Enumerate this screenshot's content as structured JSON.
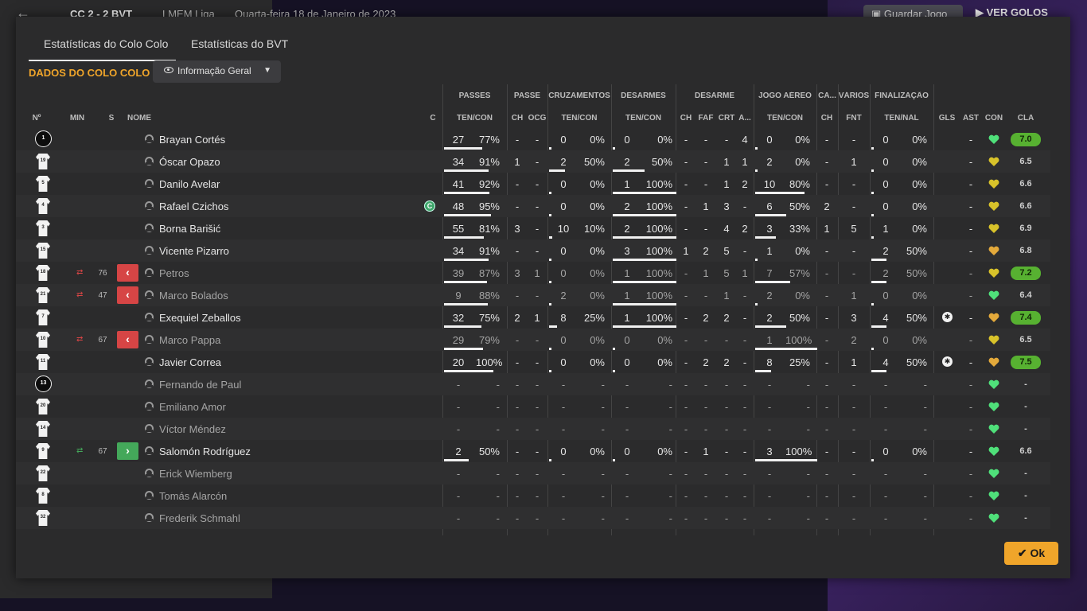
{
  "topbar": {
    "back_icon": "arrow-left-icon",
    "score": "CC  2 - 2  BVT",
    "competition": "LMEM Liga",
    "date": "Quarta-feira 18 de Janeiro de 2023",
    "save_label": "Guardar Jogo",
    "save_icon": "save-icon",
    "goals_label": "VER GOLOS"
  },
  "tabs": [
    {
      "label": "Estatísticas do Colo Colo",
      "active": true
    },
    {
      "label": "Estatísticas do BVT",
      "active": false
    }
  ],
  "team_heading": "DADOS DO COLO COLO",
  "view_dropdown": {
    "label": "Informação Geral",
    "icon": "eye-icon"
  },
  "groups": {
    "passes": "PASSES",
    "passe": "PASSE",
    "cruzamentos": "CRUZAMENTOS",
    "desarmes": "DESARMES",
    "desarme": "DESARME",
    "jogo_aereo": "JOGO AÉREO",
    "ca": "CA...",
    "varios": "VÁRIOS",
    "finalizacao": "FINALIZAÇÃO"
  },
  "columns": {
    "num": "Nº",
    "min": "MIN",
    "s": "S",
    "nome": "NOME",
    "c": "C",
    "ten_con": "TEN/CON",
    "ch": "CH",
    "ocg": "OCG",
    "faf": "FAF",
    "crt": "CRT",
    "a": "A...",
    "fnt": "FNT",
    "ten_nal": "TEN/NAL",
    "gls": "GLS",
    "ast": "AST",
    "con": "CON",
    "cla": "CLA"
  },
  "rows": [
    {
      "num": "1",
      "gk": true,
      "name": "Brayan Cortés",
      "dim": false,
      "min": "",
      "sub": "",
      "cap": false,
      "pass": [
        "27",
        "77%"
      ],
      "pass_fill": 0.77,
      "pch": "-",
      "ocg": "-",
      "cross": [
        "0",
        "0%"
      ],
      "cross_fill": 0,
      "tack": [
        "0",
        "0%"
      ],
      "tack_fill": 0,
      "dch": "-",
      "faf": "-",
      "crt": "-",
      "a": "4",
      "air": [
        "0",
        "0%"
      ],
      "air_fill": 0,
      "cach": "-",
      "fnt": "-",
      "shot": [
        "0",
        "0%"
      ],
      "shot_fill": 0,
      "gls": "",
      "ast": "-",
      "morale": "green",
      "rating": "7.0",
      "rating_hi": true
    },
    {
      "num": "19",
      "gk": false,
      "name": "Óscar Opazo",
      "dim": false,
      "min": "",
      "sub": "",
      "cap": false,
      "pass": [
        "34",
        "91%"
      ],
      "pass_fill": 0.91,
      "pch": "1",
      "ocg": "-",
      "cross": [
        "2",
        "50%"
      ],
      "cross_fill": 0.5,
      "tack": [
        "2",
        "50%"
      ],
      "tack_fill": 0.5,
      "dch": "-",
      "faf": "-",
      "crt": "1",
      "a": "1",
      "air": [
        "2",
        "0%"
      ],
      "air_fill": 0,
      "cach": "-",
      "fnt": "1",
      "shot": [
        "0",
        "0%"
      ],
      "shot_fill": 0,
      "gls": "",
      "ast": "-",
      "morale": "yellow",
      "rating": "6.5",
      "rating_hi": false
    },
    {
      "num": "5",
      "gk": false,
      "name": "Danilo Avelar",
      "dim": false,
      "min": "",
      "sub": "",
      "cap": false,
      "pass": [
        "41",
        "92%"
      ],
      "pass_fill": 0.92,
      "pch": "-",
      "ocg": "-",
      "cross": [
        "0",
        "0%"
      ],
      "cross_fill": 0,
      "tack": [
        "1",
        "100%"
      ],
      "tack_fill": 1,
      "dch": "-",
      "faf": "-",
      "crt": "1",
      "a": "2",
      "air": [
        "10",
        "80%"
      ],
      "air_fill": 0.8,
      "cach": "-",
      "fnt": "-",
      "shot": [
        "0",
        "0%"
      ],
      "shot_fill": 0,
      "gls": "",
      "ast": "-",
      "morale": "yellow",
      "rating": "6.6",
      "rating_hi": false
    },
    {
      "num": "4",
      "gk": false,
      "name": "Rafael Czichos",
      "dim": false,
      "min": "",
      "sub": "",
      "cap": true,
      "pass": [
        "48",
        "95%"
      ],
      "pass_fill": 0.95,
      "pch": "-",
      "ocg": "-",
      "cross": [
        "0",
        "0%"
      ],
      "cross_fill": 0,
      "tack": [
        "2",
        "100%"
      ],
      "tack_fill": 1,
      "dch": "-",
      "faf": "1",
      "crt": "3",
      "a": "-",
      "air": [
        "6",
        "50%"
      ],
      "air_fill": 0.5,
      "cach": "2",
      "fnt": "-",
      "shot": [
        "0",
        "0%"
      ],
      "shot_fill": 0,
      "gls": "",
      "ast": "-",
      "morale": "yellow",
      "rating": "6.6",
      "rating_hi": false
    },
    {
      "num": "3",
      "gk": false,
      "name": "Borna Barišić",
      "dim": false,
      "min": "",
      "sub": "",
      "cap": false,
      "pass": [
        "55",
        "81%"
      ],
      "pass_fill": 0.81,
      "pch": "3",
      "ocg": "-",
      "cross": [
        "10",
        "10%"
      ],
      "cross_fill": 0.1,
      "tack": [
        "2",
        "100%"
      ],
      "tack_fill": 1,
      "dch": "-",
      "faf": "-",
      "crt": "4",
      "a": "2",
      "air": [
        "3",
        "33%"
      ],
      "air_fill": 0.33,
      "cach": "1",
      "fnt": "5",
      "shot": [
        "1",
        "0%"
      ],
      "shot_fill": 0,
      "gls": "",
      "ast": "-",
      "morale": "yellow",
      "rating": "6.9",
      "rating_hi": false
    },
    {
      "num": "15",
      "gk": false,
      "name": "Vicente Pizarro",
      "dim": false,
      "min": "",
      "sub": "",
      "cap": false,
      "pass": [
        "34",
        "91%"
      ],
      "pass_fill": 0.91,
      "pch": "-",
      "ocg": "-",
      "cross": [
        "0",
        "0%"
      ],
      "cross_fill": 0,
      "tack": [
        "3",
        "100%"
      ],
      "tack_fill": 1,
      "dch": "1",
      "faf": "2",
      "crt": "5",
      "a": "-",
      "air": [
        "1",
        "0%"
      ],
      "air_fill": 0,
      "cach": "-",
      "fnt": "-",
      "shot": [
        "2",
        "50%"
      ],
      "shot_fill": 0.5,
      "gls": "",
      "ast": "-",
      "morale": "orange",
      "rating": "6.8",
      "rating_hi": false
    },
    {
      "num": "18",
      "gk": false,
      "name": "Petros",
      "dim": true,
      "min": "76",
      "sub": "off",
      "cap": false,
      "pass": [
        "39",
        "87%"
      ],
      "pass_fill": 0.87,
      "pch": "3",
      "ocg": "1",
      "cross": [
        "0",
        "0%"
      ],
      "cross_fill": 0,
      "tack": [
        "1",
        "100%"
      ],
      "tack_fill": 1,
      "dch": "-",
      "faf": "1",
      "crt": "5",
      "a": "1",
      "air": [
        "7",
        "57%"
      ],
      "air_fill": 0.57,
      "cach": "-",
      "fnt": "-",
      "shot": [
        "2",
        "50%"
      ],
      "shot_fill": 0.5,
      "gls": "",
      "ast": "-",
      "morale": "yellow",
      "rating": "7.2",
      "rating_hi": true
    },
    {
      "num": "21",
      "gk": false,
      "name": "Marco Bolados",
      "dim": true,
      "min": "47",
      "sub": "off",
      "cap": false,
      "pass": [
        "9",
        "88%"
      ],
      "pass_fill": 0.88,
      "pch": "-",
      "ocg": "-",
      "cross": [
        "2",
        "0%"
      ],
      "cross_fill": 0,
      "tack": [
        "1",
        "100%"
      ],
      "tack_fill": 1,
      "dch": "-",
      "faf": "-",
      "crt": "1",
      "a": "-",
      "air": [
        "2",
        "0%"
      ],
      "air_fill": 0,
      "cach": "-",
      "fnt": "1",
      "shot": [
        "0",
        "0%"
      ],
      "shot_fill": 0,
      "gls": "",
      "ast": "-",
      "morale": "green",
      "rating": "6.4",
      "rating_hi": false
    },
    {
      "num": "7",
      "gk": false,
      "name": "Exequiel Zeballos",
      "dim": false,
      "min": "",
      "sub": "",
      "cap": false,
      "pass": [
        "32",
        "75%"
      ],
      "pass_fill": 0.75,
      "pch": "2",
      "ocg": "1",
      "cross": [
        "8",
        "25%"
      ],
      "cross_fill": 0.25,
      "tack": [
        "1",
        "100%"
      ],
      "tack_fill": 1,
      "dch": "-",
      "faf": "2",
      "crt": "2",
      "a": "-",
      "air": [
        "2",
        "50%"
      ],
      "air_fill": 0.5,
      "cach": "-",
      "fnt": "3",
      "shot": [
        "4",
        "50%"
      ],
      "shot_fill": 0.5,
      "gls": "ball",
      "ast": "-",
      "morale": "orange",
      "rating": "7.4",
      "rating_hi": true
    },
    {
      "num": "10",
      "gk": false,
      "name": "Marco Pappa",
      "dim": true,
      "min": "67",
      "sub": "off",
      "cap": false,
      "pass": [
        "29",
        "79%"
      ],
      "pass_fill": 0.79,
      "pch": "-",
      "ocg": "-",
      "cross": [
        "0",
        "0%"
      ],
      "cross_fill": 0,
      "tack": [
        "0",
        "0%"
      ],
      "tack_fill": 0,
      "dch": "-",
      "faf": "-",
      "crt": "-",
      "a": "-",
      "air": [
        "1",
        "100%"
      ],
      "air_fill": 1,
      "cach": "-",
      "fnt": "2",
      "shot": [
        "0",
        "0%"
      ],
      "shot_fill": 0,
      "gls": "",
      "ast": "-",
      "morale": "yellow",
      "rating": "6.5",
      "rating_hi": false
    },
    {
      "num": "11",
      "gk": false,
      "name": "Javier Correa",
      "dim": false,
      "min": "",
      "sub": "",
      "cap": false,
      "pass": [
        "20",
        "100%"
      ],
      "pass_fill": 1,
      "pch": "-",
      "ocg": "-",
      "cross": [
        "0",
        "0%"
      ],
      "cross_fill": 0,
      "tack": [
        "0",
        "0%"
      ],
      "tack_fill": 0,
      "dch": "-",
      "faf": "2",
      "crt": "2",
      "a": "-",
      "air": [
        "8",
        "25%"
      ],
      "air_fill": 0.25,
      "cach": "-",
      "fnt": "1",
      "shot": [
        "4",
        "50%"
      ],
      "shot_fill": 0.5,
      "gls": "ball",
      "ast": "-",
      "morale": "orange",
      "rating": "7.5",
      "rating_hi": true
    },
    {
      "num": "13",
      "gk": true,
      "name": "Fernando de Paul",
      "dim": true,
      "min": "",
      "sub": "",
      "cap": false,
      "pass": [
        "-",
        "-"
      ],
      "pass_fill": null,
      "pch": "-",
      "ocg": "-",
      "cross": [
        "-",
        "-"
      ],
      "cross_fill": null,
      "tack": [
        "-",
        "-"
      ],
      "tack_fill": null,
      "dch": "-",
      "faf": "-",
      "crt": "-",
      "a": "-",
      "air": [
        "-",
        "-"
      ],
      "air_fill": null,
      "cach": "-",
      "fnt": "-",
      "shot": [
        "-",
        "-"
      ],
      "shot_fill": null,
      "gls": "",
      "ast": "-",
      "morale": "green",
      "rating": "-",
      "rating_hi": false
    },
    {
      "num": "20",
      "gk": false,
      "name": "Emiliano Amor",
      "dim": true,
      "min": "",
      "sub": "",
      "cap": false,
      "pass": [
        "-",
        "-"
      ],
      "pass_fill": null,
      "pch": "-",
      "ocg": "-",
      "cross": [
        "-",
        "-"
      ],
      "cross_fill": null,
      "tack": [
        "-",
        "-"
      ],
      "tack_fill": null,
      "dch": "-",
      "faf": "-",
      "crt": "-",
      "a": "-",
      "air": [
        "-",
        "-"
      ],
      "air_fill": null,
      "cach": "-",
      "fnt": "-",
      "shot": [
        "-",
        "-"
      ],
      "shot_fill": null,
      "gls": "",
      "ast": "-",
      "morale": "green",
      "rating": "-",
      "rating_hi": false
    },
    {
      "num": "14",
      "gk": false,
      "name": "Víctor Méndez",
      "dim": true,
      "min": "",
      "sub": "",
      "cap": false,
      "pass": [
        "-",
        "-"
      ],
      "pass_fill": null,
      "pch": "-",
      "ocg": "-",
      "cross": [
        "-",
        "-"
      ],
      "cross_fill": null,
      "tack": [
        "-",
        "-"
      ],
      "tack_fill": null,
      "dch": "-",
      "faf": "-",
      "crt": "-",
      "a": "-",
      "air": [
        "-",
        "-"
      ],
      "air_fill": null,
      "cach": "-",
      "fnt": "-",
      "shot": [
        "-",
        "-"
      ],
      "shot_fill": null,
      "gls": "",
      "ast": "-",
      "morale": "green",
      "rating": "-",
      "rating_hi": false
    },
    {
      "num": "9",
      "gk": false,
      "name": "Salomón Rodríguez",
      "dim": false,
      "min": "67",
      "sub": "on",
      "cap": false,
      "pass": [
        "2",
        "50%"
      ],
      "pass_fill": 0.5,
      "pch": "-",
      "ocg": "-",
      "cross": [
        "0",
        "0%"
      ],
      "cross_fill": 0,
      "tack": [
        "0",
        "0%"
      ],
      "tack_fill": 0,
      "dch": "-",
      "faf": "1",
      "crt": "-",
      "a": "-",
      "air": [
        "3",
        "100%"
      ],
      "air_fill": 1,
      "cach": "-",
      "fnt": "-",
      "shot": [
        "0",
        "0%"
      ],
      "shot_fill": 0,
      "gls": "",
      "ast": "-",
      "morale": "green",
      "rating": "6.6",
      "rating_hi": false
    },
    {
      "num": "22",
      "gk": false,
      "name": "Erick Wiemberg",
      "dim": true,
      "min": "",
      "sub": "",
      "cap": false,
      "pass": [
        "-",
        "-"
      ],
      "pass_fill": null,
      "pch": "-",
      "ocg": "-",
      "cross": [
        "-",
        "-"
      ],
      "cross_fill": null,
      "tack": [
        "-",
        "-"
      ],
      "tack_fill": null,
      "dch": "-",
      "faf": "-",
      "crt": "-",
      "a": "-",
      "air": [
        "-",
        "-"
      ],
      "air_fill": null,
      "cach": "-",
      "fnt": "-",
      "shot": [
        "-",
        "-"
      ],
      "shot_fill": null,
      "gls": "",
      "ast": "-",
      "morale": "green",
      "rating": "-",
      "rating_hi": false
    },
    {
      "num": "8",
      "gk": false,
      "name": "Tomás Alarcón",
      "dim": true,
      "min": "",
      "sub": "",
      "cap": false,
      "pass": [
        "-",
        "-"
      ],
      "pass_fill": null,
      "pch": "-",
      "ocg": "-",
      "cross": [
        "-",
        "-"
      ],
      "cross_fill": null,
      "tack": [
        "-",
        "-"
      ],
      "tack_fill": null,
      "dch": "-",
      "faf": "-",
      "crt": "-",
      "a": "-",
      "air": [
        "-",
        "-"
      ],
      "air_fill": null,
      "cach": "-",
      "fnt": "-",
      "shot": [
        "-",
        "-"
      ],
      "shot_fill": null,
      "gls": "",
      "ast": "-",
      "morale": "green",
      "rating": "-",
      "rating_hi": false
    },
    {
      "num": "32",
      "gk": false,
      "name": "Frederik Schmahl",
      "dim": true,
      "min": "",
      "sub": "",
      "cap": false,
      "pass": [
        "-",
        "-"
      ],
      "pass_fill": null,
      "pch": "-",
      "ocg": "-",
      "cross": [
        "-",
        "-"
      ],
      "cross_fill": null,
      "tack": [
        "-",
        "-"
      ],
      "tack_fill": null,
      "dch": "-",
      "faf": "-",
      "crt": "-",
      "a": "-",
      "air": [
        "-",
        "-"
      ],
      "air_fill": null,
      "cach": "-",
      "fnt": "-",
      "shot": [
        "-",
        "-"
      ],
      "shot_fill": null,
      "gls": "",
      "ast": "-",
      "morale": "green",
      "rating": "-",
      "rating_hi": false
    }
  ],
  "ok_label": "Ok",
  "ok_icon": "check-icon",
  "colors": {
    "accent": "#f0a52a",
    "green": "#4fe07a",
    "yellow": "#d8c22a",
    "orange": "#e3a93b",
    "sub_off": "#d64545",
    "sub_on": "#44a85a",
    "rating_hi": "#57b131"
  }
}
